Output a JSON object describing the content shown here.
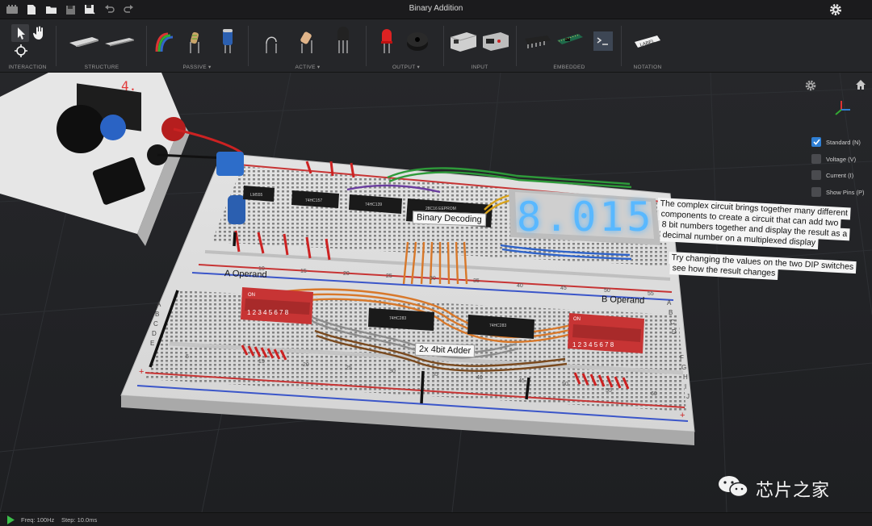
{
  "window": {
    "title": "Binary Addition"
  },
  "toolbar": {
    "groups": [
      {
        "label": "INTERACTION"
      },
      {
        "label": "STRUCTURE"
      },
      {
        "label": "PASSIVE ▾"
      },
      {
        "label": "ACTIVE ▾"
      },
      {
        "label": "OUTPUT ▾"
      },
      {
        "label": "INPUT"
      },
      {
        "label": "EMBEDDED"
      },
      {
        "label": "NOTATION"
      }
    ],
    "label_tool_text": "LABEL"
  },
  "viewport": {
    "toggles": [
      {
        "label": "Standard (N)",
        "checked": true
      },
      {
        "label": "Voltage (V)",
        "checked": false
      },
      {
        "label": "Current (I)",
        "checked": false
      },
      {
        "label": "Show Pins (P)",
        "checked": false
      }
    ],
    "notes": {
      "line1": "The complex circuit brings together many different",
      "line2": "components to create a circuit that can add two",
      "line3": "8 bit numbers together and display the result as a",
      "line4": "decimal number on a multiplexed display",
      "line5": "Try changing the values on the two DIP switches",
      "line6": "see how the result changes"
    },
    "board_labels": {
      "decoding": "Binary Decoding",
      "adder": "2x 4bit Adder",
      "a_operand": "A Operand",
      "b_operand": "B Operand"
    },
    "display_digits": "8.015",
    "psu_readout": "4.",
    "chip_labels": {
      "timer": "LM555",
      "counter": "74HC157",
      "decoder": "74HC139",
      "eeprom": "28C16 EEPROM",
      "adder1": "74HC283",
      "adder2": "74HC283"
    },
    "dip_on": "ON",
    "dip_numbers": [
      "1",
      "2",
      "3",
      "4",
      "5",
      "6",
      "7",
      "8"
    ],
    "column_numbers_top": [
      "10",
      "15",
      "20",
      "25",
      "30",
      "35",
      "40",
      "45",
      "50",
      "55",
      "60"
    ],
    "column_numbers_bottom": [
      "5",
      "10",
      "15",
      "20",
      "25",
      "30",
      "35",
      "40",
      "45",
      "50",
      "55",
      "60"
    ],
    "row_letters": [
      "A",
      "B",
      "C",
      "D",
      "E"
    ],
    "row_letters_right": [
      "F",
      "G",
      "H",
      "I",
      "J"
    ]
  },
  "status": {
    "freq": "Freq: 100Hz",
    "step": "Step: 10.0ms"
  },
  "watermark": {
    "text": "芯片之家"
  },
  "colors": {
    "accent": "#2f7fd4",
    "display": "#59b8ff",
    "board": "#e9e9e9",
    "wire_orange": "#d8782a",
    "wire_red": "#d02a2a",
    "dip": "#c73434"
  }
}
